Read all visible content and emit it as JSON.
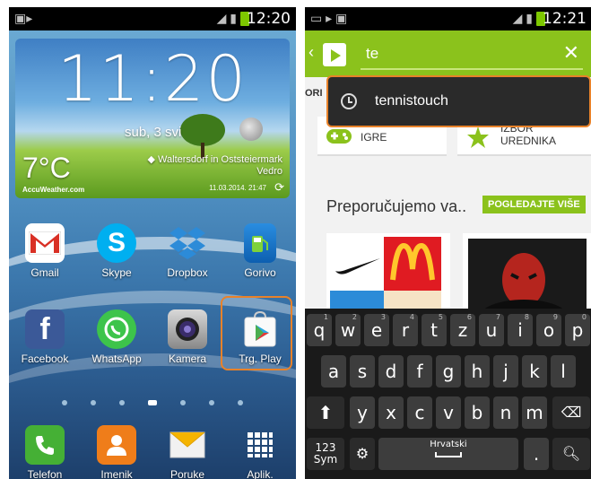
{
  "left": {
    "status": {
      "time": "12:20"
    },
    "clock_widget": {
      "time": "11:20",
      "date": "sub, 3 svi",
      "temperature": "7°C",
      "location": "Waltersdorf in Oststeiermark",
      "condition": "Vedro",
      "provider": "AccuWeather.com",
      "updated": "11.03.2014. 21:47"
    },
    "apps_row1": [
      {
        "label": "Gmail",
        "icon": "gmail-icon"
      },
      {
        "label": "Skype",
        "icon": "skype-icon"
      },
      {
        "label": "Dropbox",
        "icon": "dropbox-icon"
      },
      {
        "label": "Gorivo",
        "icon": "fuel-icon"
      }
    ],
    "apps_row2": [
      {
        "label": "Facebook",
        "icon": "facebook-icon"
      },
      {
        "label": "WhatsApp",
        "icon": "whatsapp-icon"
      },
      {
        "label": "Kamera",
        "icon": "camera-icon"
      },
      {
        "label": "Trg. Play",
        "icon": "play-store-icon"
      }
    ],
    "dock": [
      {
        "label": "Telefon",
        "icon": "phone-icon"
      },
      {
        "label": "Imenik",
        "icon": "contacts-icon"
      },
      {
        "label": "Poruke",
        "icon": "messages-icon"
      },
      {
        "label": "Aplik.",
        "icon": "apps-grid-icon"
      }
    ],
    "page_count": 7,
    "active_page": 4
  },
  "right": {
    "status": {
      "time": "12:21"
    },
    "search": {
      "query": "te"
    },
    "tab_partial": "ORI",
    "categories": [
      {
        "label": "IGRE",
        "icon": "gamepad-icon"
      },
      {
        "label": "IZBOR UREDNIKA",
        "icon": "star-icon"
      }
    ],
    "recommended": {
      "title": "Preporučujemo va..",
      "button": "POGLEDAJTE VIŠE"
    },
    "suggestion": {
      "text": "tennistouch",
      "icon": "history-clock-icon"
    },
    "keyboard": {
      "row1": [
        {
          "k": "q",
          "h": "1"
        },
        {
          "k": "w",
          "h": "2"
        },
        {
          "k": "e",
          "h": "3"
        },
        {
          "k": "r",
          "h": "4"
        },
        {
          "k": "t",
          "h": "5"
        },
        {
          "k": "z",
          "h": "6"
        },
        {
          "k": "u",
          "h": "7"
        },
        {
          "k": "i",
          "h": "8"
        },
        {
          "k": "o",
          "h": "9"
        },
        {
          "k": "p",
          "h": "0"
        }
      ],
      "row2": [
        "a",
        "s",
        "d",
        "f",
        "g",
        "h",
        "j",
        "k",
        "l"
      ],
      "row3": [
        "y",
        "x",
        "c",
        "v",
        "b",
        "n",
        "m"
      ],
      "sym_label_1": "123",
      "sym_label_2": "Sym",
      "space_label": "Hrvatski"
    }
  },
  "colors": {
    "play_green": "#8bc21c",
    "highlight": "#e8822a"
  }
}
